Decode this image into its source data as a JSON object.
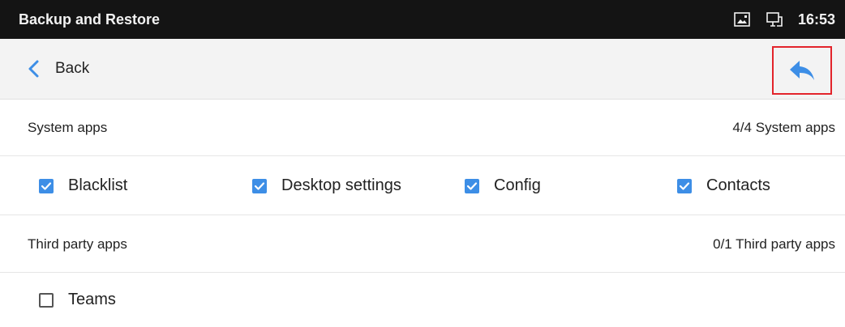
{
  "status_bar": {
    "title": "Backup and Restore",
    "time": "16:53",
    "icons": [
      "gallery-icon",
      "monitor-icon"
    ]
  },
  "nav": {
    "back_label": "Back",
    "back_icon": "chevron-left-icon",
    "restore_icon": "reply-arrow-icon"
  },
  "colors": {
    "accent": "#3d8ee6",
    "highlight_border": "#e3242b",
    "status_bar_bg": "#141414",
    "nav_bg": "#f3f3f3"
  },
  "system_apps": {
    "title": "System apps",
    "count": "4/4  System apps",
    "items": [
      {
        "label": "Blacklist",
        "checked": true
      },
      {
        "label": "Desktop settings",
        "checked": true
      },
      {
        "label": "Config",
        "checked": true
      },
      {
        "label": "Contacts",
        "checked": true
      }
    ]
  },
  "third_party_apps": {
    "title": "Third party apps",
    "count": "0/1  Third party apps",
    "items": [
      {
        "label": "Teams",
        "checked": false
      }
    ]
  }
}
